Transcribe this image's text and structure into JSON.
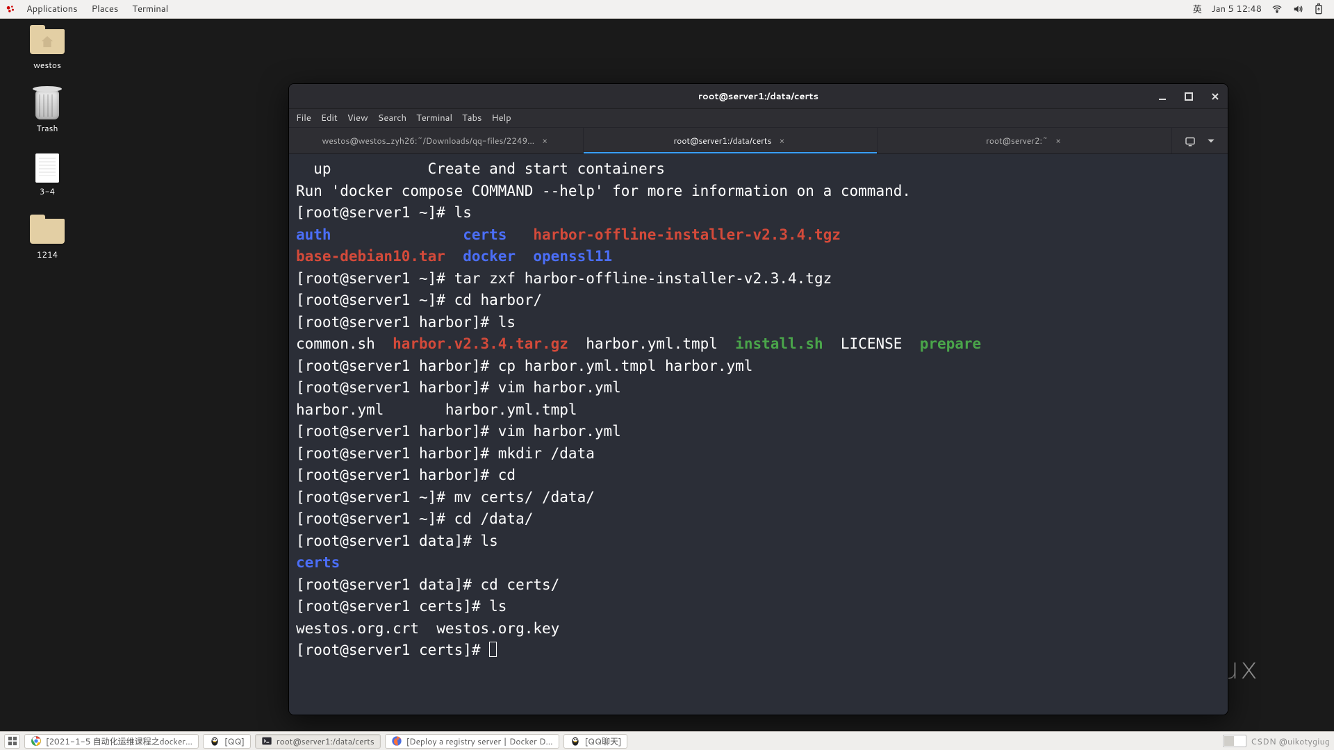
{
  "top_panel": {
    "menu": [
      "Applications",
      "Places",
      "Terminal"
    ],
    "ime": "英",
    "clock": "Jan 5  12:48"
  },
  "desktop": {
    "icons": [
      {
        "kind": "home-folder",
        "label": "westos"
      },
      {
        "kind": "trash",
        "label": "Trash"
      },
      {
        "kind": "document",
        "label": "3-4"
      },
      {
        "kind": "folder",
        "label": "1214"
      }
    ]
  },
  "watermark": "lux",
  "terminal_window": {
    "title": "root@server1:/data/certs",
    "menu": [
      "File",
      "Edit",
      "View",
      "Search",
      "Terminal",
      "Tabs",
      "Help"
    ],
    "tabs": [
      {
        "label": "westos@westos_zyh26:~/Downloads/qq-files/2249…",
        "active": false
      },
      {
        "label": "root@server1:/data/certs",
        "active": true
      },
      {
        "label": "root@server2:~",
        "active": false
      }
    ],
    "lines": [
      [
        {
          "t": "  up           Create and start containers"
        }
      ],
      [
        {
          "t": ""
        }
      ],
      [
        {
          "t": "Run 'docker compose COMMAND --help' for more information on a command."
        }
      ],
      [
        {
          "t": "[root@server1 ~]# ls"
        }
      ],
      [
        {
          "t": "auth",
          "c": "blue"
        },
        {
          "t": "               "
        },
        {
          "t": "certs",
          "c": "blue"
        },
        {
          "t": "   "
        },
        {
          "t": "harbor-offline-installer-v2.3.4.tgz",
          "c": "red"
        }
      ],
      [
        {
          "t": "base-debian10.tar",
          "c": "red"
        },
        {
          "t": "  "
        },
        {
          "t": "docker",
          "c": "blue"
        },
        {
          "t": "  "
        },
        {
          "t": "openssl11",
          "c": "blue"
        }
      ],
      [
        {
          "t": "[root@server1 ~]# tar zxf harbor-offline-installer-v2.3.4.tgz"
        }
      ],
      [
        {
          "t": "[root@server1 ~]# cd harbor/"
        }
      ],
      [
        {
          "t": "[root@server1 harbor]# ls"
        }
      ],
      [
        {
          "t": "common.sh  "
        },
        {
          "t": "harbor.v2.3.4.tar.gz",
          "c": "red"
        },
        {
          "t": "  harbor.yml.tmpl  "
        },
        {
          "t": "install.sh",
          "c": "lgreen"
        },
        {
          "t": "  LICENSE  "
        },
        {
          "t": "prepare",
          "c": "lgreen"
        }
      ],
      [
        {
          "t": "[root@server1 harbor]# cp harbor.yml.tmpl harbor.yml"
        }
      ],
      [
        {
          "t": "[root@server1 harbor]# vim harbor.yml"
        }
      ],
      [
        {
          "t": "harbor.yml       harbor.yml.tmpl"
        }
      ],
      [
        {
          "t": "[root@server1 harbor]# vim harbor.yml"
        }
      ],
      [
        {
          "t": "[root@server1 harbor]# mkdir /data"
        }
      ],
      [
        {
          "t": "[root@server1 harbor]# cd"
        }
      ],
      [
        {
          "t": "[root@server1 ~]# mv certs/ /data/"
        }
      ],
      [
        {
          "t": "[root@server1 ~]# cd /data/"
        }
      ],
      [
        {
          "t": "[root@server1 data]# ls"
        }
      ],
      [
        {
          "t": "certs",
          "c": "blue"
        }
      ],
      [
        {
          "t": "[root@server1 data]# cd certs/"
        }
      ],
      [
        {
          "t": "[root@server1 certs]# ls"
        }
      ],
      [
        {
          "t": "westos.org.crt  westos.org.key"
        }
      ],
      [
        {
          "t": "[root@server1 certs]# "
        },
        {
          "cursor": true
        }
      ]
    ]
  },
  "bottom_panel": {
    "tasks": [
      {
        "icon": "chrome",
        "label": "[2021-1-5 自动化运维课程之docker…"
      },
      {
        "icon": "qq",
        "label": "[QQ]"
      },
      {
        "icon": "terminal",
        "label": "root@server1:/data/certs",
        "active": true
      },
      {
        "icon": "firefox",
        "label": "[Deploy a registry server | Docker D…"
      },
      {
        "icon": "qq",
        "label": "[QQ聊天]"
      }
    ],
    "brand": "CSDN @uikotygiug"
  }
}
